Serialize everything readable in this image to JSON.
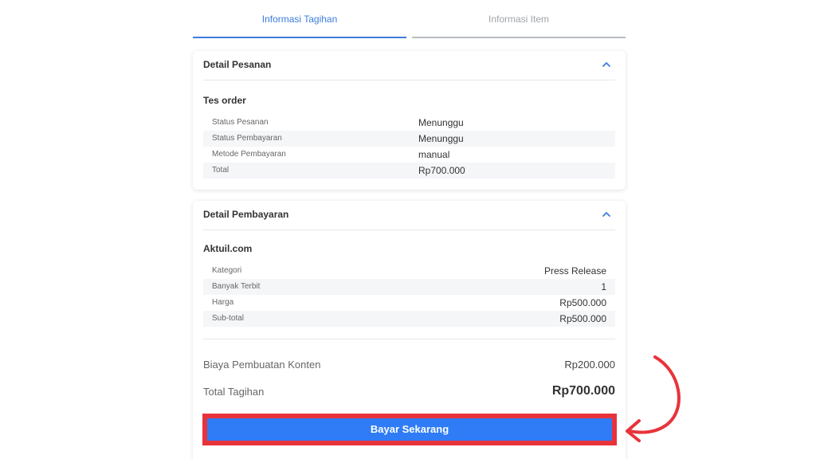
{
  "tabs": [
    {
      "label": "Informasi Tagihan",
      "active": true
    },
    {
      "label": "Informasi Item",
      "active": false
    }
  ],
  "order_card": {
    "title": "Detail Pesanan",
    "subtitle": "Tes order",
    "rows": [
      {
        "label": "Status Pesanan",
        "value": "Menunggu"
      },
      {
        "label": "Status Pembayaran",
        "value": "Menunggu"
      },
      {
        "label": "Metode Pembayaran",
        "value": "manual"
      },
      {
        "label": "Total",
        "value": "Rp700.000"
      }
    ]
  },
  "payment_card": {
    "title": "Detail Pembayaran",
    "subtitle": "Aktuil.com",
    "rows": [
      {
        "label": "Kategori",
        "value": "Press Release"
      },
      {
        "label": "Banyak Terbit",
        "value": "1"
      },
      {
        "label": "Harga",
        "value": "Rp500.000"
      },
      {
        "label": "Sub-total",
        "value": "Rp500.000"
      }
    ],
    "content_fee_label": "Biaya Pembuatan Konten",
    "content_fee_value": "Rp200.000",
    "total_label": "Total Tagihan",
    "total_value": "Rp700.000"
  },
  "pay_button_label": "Bayar Sekarang",
  "colors": {
    "accent": "#3b7ddd",
    "button": "#2f7cf6",
    "highlight": "#e8333b"
  }
}
